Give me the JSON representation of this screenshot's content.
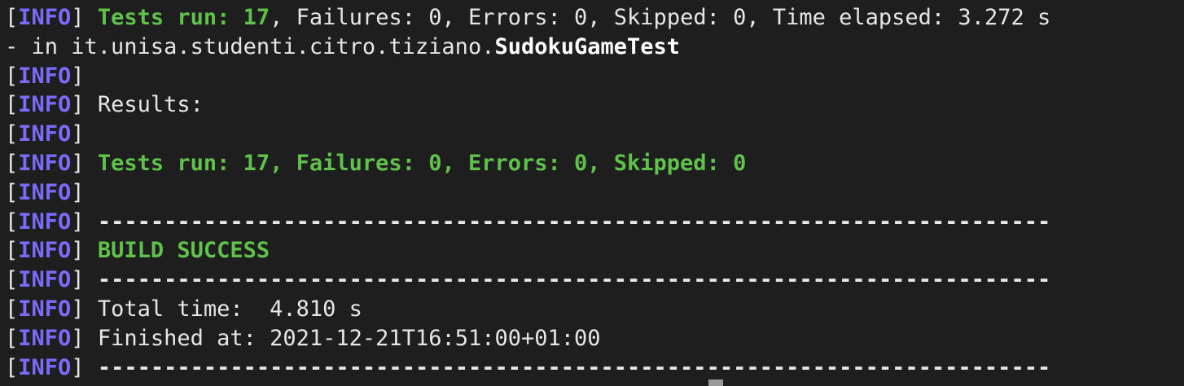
{
  "tag": {
    "open": "[",
    "level": "INFO",
    "close": "]"
  },
  "lines": {
    "l1": {
      "stats_bold": "Tests run: 17",
      "stats_rest": ", Failures: 0, Errors: 0, Skipped: 0, Time elapsed: 3.272 s"
    },
    "l2": {
      "prefix": "- in it.unisa.studenti.citro.tiziano.",
      "classname": "SudokuGameTest"
    },
    "l4": {
      "text": " Results:"
    },
    "l6": {
      "text": " Tests run: 17, Failures: 0, Errors: 0, Skipped: 0"
    },
    "separator": " ------------------------------------------------------------------------",
    "l9": {
      "text": " BUILD SUCCESS"
    },
    "l11": {
      "text": " Total time:  4.810 s"
    },
    "l12": {
      "text": " Finished at: 2021-12-21T16:51:00+01:00"
    }
  }
}
